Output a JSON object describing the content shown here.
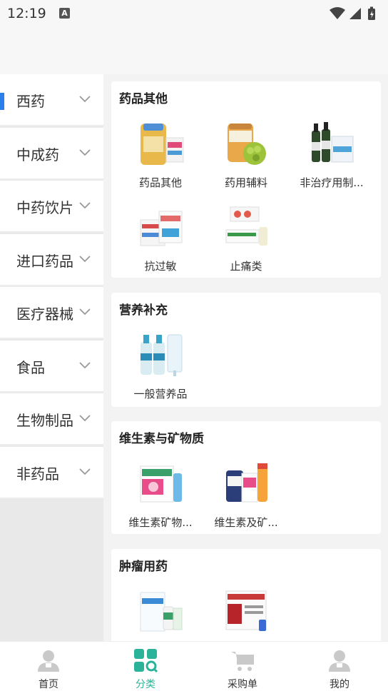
{
  "status_bar": {
    "time": "12:19",
    "notification_letter": "A"
  },
  "colors": {
    "accent": "#2bb39a",
    "active_indicator": "#2a7fe8",
    "inactive_icon": "#c9c9c9"
  },
  "sidebar": {
    "items": [
      {
        "label": "西药",
        "active": true
      },
      {
        "label": "中成药"
      },
      {
        "label": "中药饮片"
      },
      {
        "label": "进口药品"
      },
      {
        "label": "医疗器械"
      },
      {
        "label": "食品"
      },
      {
        "label": "生物制品"
      },
      {
        "label": "非药品"
      }
    ]
  },
  "sections": [
    {
      "title": "药品其他",
      "items": [
        "药品其他",
        "药用辅料",
        "非治疗用制...",
        "抗过敏",
        "止痛类"
      ]
    },
    {
      "title": "营养补充",
      "items": [
        "一般营养品"
      ]
    },
    {
      "title": "维生素与矿物质",
      "items": [
        "维生素矿物...",
        "维生素及矿..."
      ]
    },
    {
      "title": "肿瘤用药",
      "items": [
        "",
        ""
      ]
    }
  ],
  "tabs": [
    {
      "label": "首页",
      "icon": "user-icon"
    },
    {
      "label": "分类",
      "icon": "category-icon",
      "active": true
    },
    {
      "label": "采购单",
      "icon": "cart-icon"
    },
    {
      "label": "我的",
      "icon": "profile-icon"
    }
  ]
}
